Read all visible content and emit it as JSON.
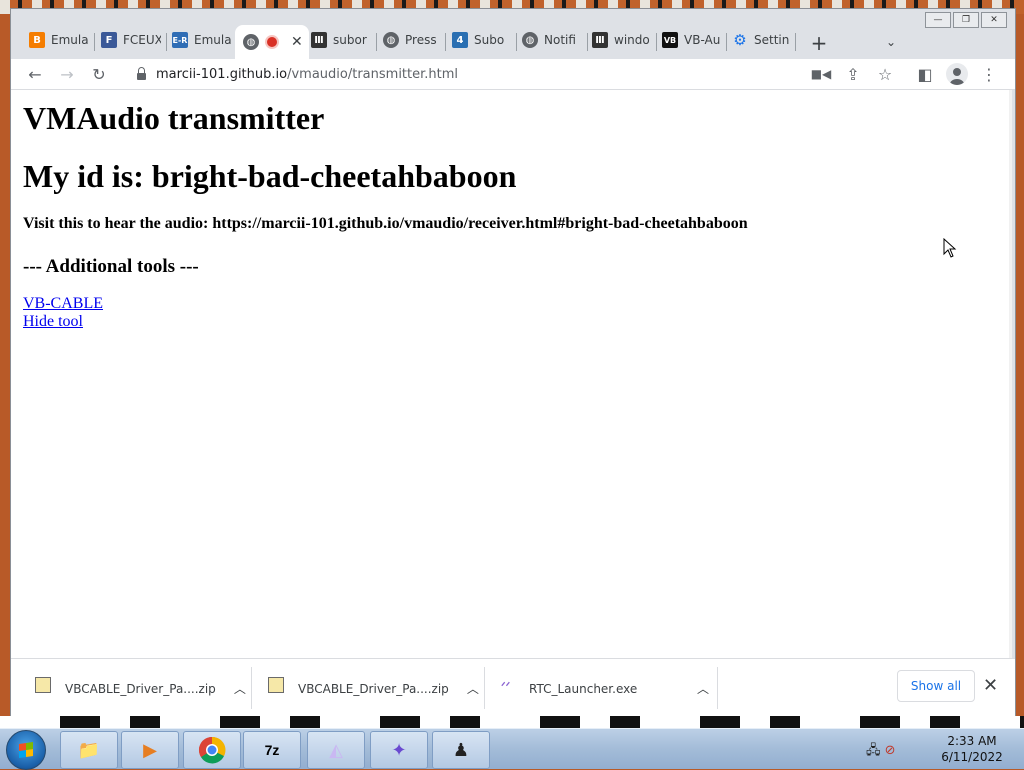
{
  "browser": {
    "tabs": [
      {
        "title": "Emula",
        "icon": "blogger-icon",
        "color": "#f57d00",
        "active": false
      },
      {
        "title": "FCEUX",
        "icon": "fceux-icon",
        "color": "#3b5998",
        "active": false
      },
      {
        "title": "Emula",
        "icon": "emu-icon",
        "color": "#2f6db5",
        "active": false
      },
      {
        "title": "",
        "icon": "globe-icon",
        "color": "#5f6368",
        "active": true,
        "recording": true
      },
      {
        "title": "subor",
        "icon": "archive-icon",
        "color": "#333333",
        "active": false
      },
      {
        "title": "Press",
        "icon": "globe-icon",
        "color": "#5f6368",
        "active": false
      },
      {
        "title": "Subo",
        "icon": "four-icon",
        "color": "#2a6fb2",
        "active": false
      },
      {
        "title": "Notifi",
        "icon": "globe-icon",
        "color": "#5f6368",
        "active": false
      },
      {
        "title": "windo",
        "icon": "archive-icon",
        "color": "#333333",
        "active": false
      },
      {
        "title": "VB-Au",
        "icon": "vb-icon",
        "color": "#111111",
        "active": false
      },
      {
        "title": "Settin",
        "icon": "gear-icon",
        "color": "#1a73e8",
        "active": false
      }
    ],
    "new_tab": "+",
    "address": {
      "host": "marcii-101.github.io",
      "path": "/vmaudio/transmitter.html"
    }
  },
  "page": {
    "title": "VMAudio transmitter",
    "id_line": "My id is: bright-bad-cheetahbaboon",
    "visit_line": "Visit this to hear the audio: https://marcii-101.github.io/vmaudio/receiver.html#bright-bad-cheetahbaboon",
    "tools_heading": "--- Additional tools ---",
    "links": [
      "VB-CABLE",
      "Hide tool"
    ]
  },
  "downloads": {
    "items": [
      {
        "name": "VBCABLE_Driver_Pa....zip",
        "icon": "zip-file-icon"
      },
      {
        "name": "VBCABLE_Driver_Pa....zip",
        "icon": "zip-file-icon"
      },
      {
        "name": "RTC_Launcher.exe",
        "icon": "exe-file-icon"
      }
    ],
    "show_all": "Show all"
  },
  "taskbar": {
    "time": "2:33 AM",
    "date": "6/11/2022",
    "apps": [
      "explorer-icon",
      "media-player-icon",
      "chrome-icon",
      "7zip-icon",
      "vmaudio-icon",
      "cat-app-icon",
      "anonymous-icon"
    ]
  }
}
